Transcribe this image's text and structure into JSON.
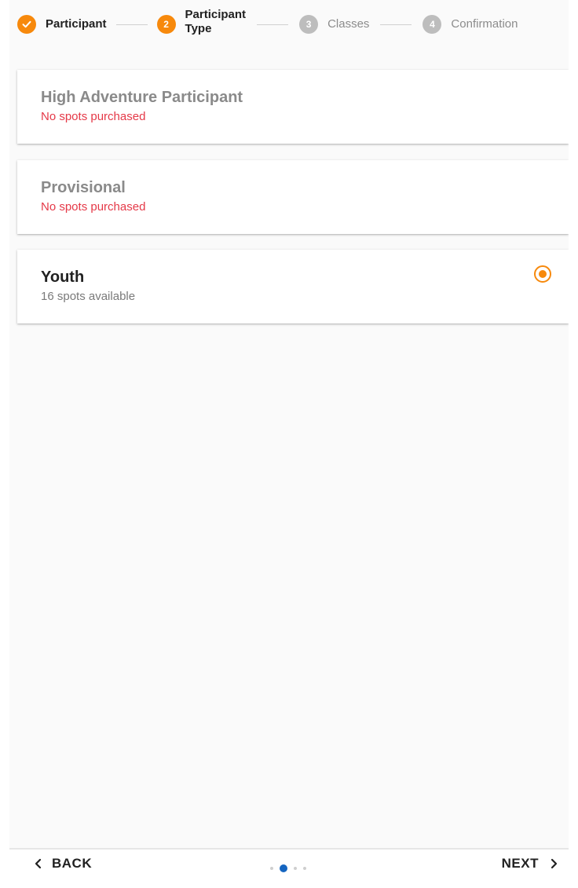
{
  "stepper": {
    "steps": [
      {
        "label": "Participant",
        "status": "completed",
        "number": "",
        "icon": "check-icon"
      },
      {
        "label_line1": "Participant",
        "label_line2": "Type",
        "status": "active",
        "number": "2"
      },
      {
        "label": "Classes",
        "status": "inactive",
        "number": "3"
      },
      {
        "label": "Confirmation",
        "status": "inactive",
        "number": "4"
      }
    ]
  },
  "participant_types": [
    {
      "title": "High Adventure Participant",
      "subtitle": "No spots purchased",
      "subtitle_status": "error",
      "enabled": false,
      "selected": false
    },
    {
      "title": "Provisional",
      "subtitle": "No spots purchased",
      "subtitle_status": "error",
      "enabled": false,
      "selected": false
    },
    {
      "title": "Youth",
      "subtitle": "16 spots available",
      "subtitle_status": "normal",
      "enabled": true,
      "selected": true
    }
  ],
  "navigation": {
    "back_label": "BACK",
    "next_label": "NEXT",
    "page_indicator": {
      "total": 4,
      "current": 2
    }
  },
  "colors": {
    "accent": "#f7890c",
    "error": "#e53948",
    "indicator_active": "#1565c0",
    "step_inactive": "#bdbdbd"
  }
}
